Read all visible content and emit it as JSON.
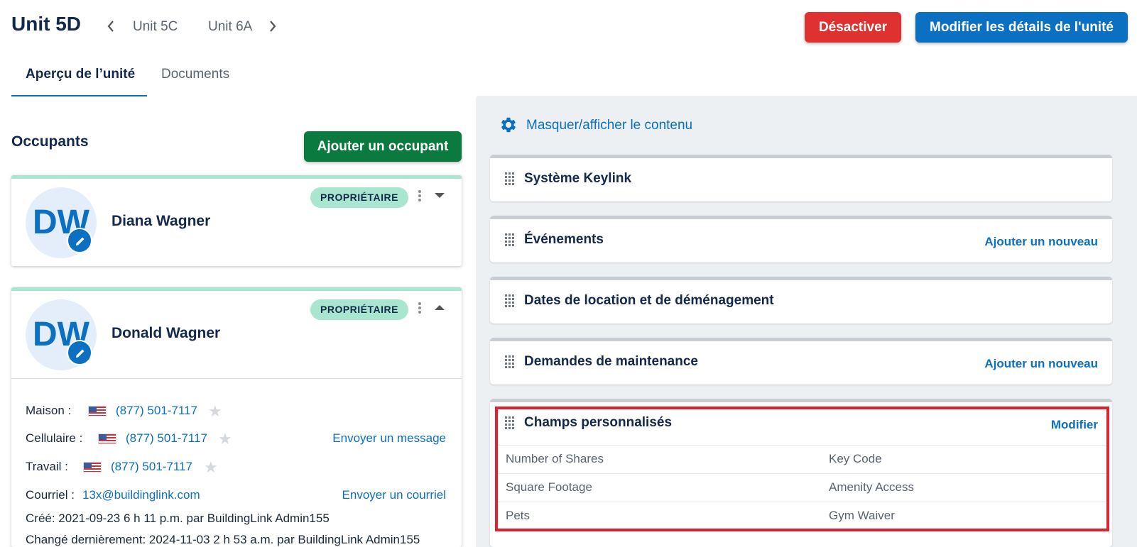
{
  "header": {
    "unit_title": "Unit 5D",
    "prev_unit": "Unit 5C",
    "next_unit": "Unit 6A",
    "deactivate_label": "Désactiver",
    "edit_unit_label": "Modifier les détails de l'unité"
  },
  "tabs": [
    {
      "label": "Aperçu de l’unité",
      "active": true
    },
    {
      "label": "Documents",
      "active": false
    }
  ],
  "occupants": {
    "title": "Occupants",
    "add_label": "Ajouter un occupant",
    "list": [
      {
        "initials": "DW",
        "name": "Diana Wagner",
        "role": "PROPRIÉTAIRE",
        "expanded": false
      },
      {
        "initials": "DW",
        "name": "Donald Wagner",
        "role": "PROPRIÉTAIRE",
        "expanded": true,
        "contacts": {
          "home_label": "Maison :",
          "home_phone": "(877) 501-7117",
          "cell_label": "Cellulaire :",
          "cell_phone": "(877) 501-7117",
          "work_label": "Travail :",
          "work_phone": "(877) 501-7117",
          "send_message": "Envoyer un message",
          "email_label": "Courriel :",
          "email": "13x@buildinglink.com",
          "send_email": "Envoyer un courriel",
          "created": "Créé:  2021-09-23 6 h 11 p.m. par BuildingLink Admin155",
          "changed": "Changé dernièrement:  2024-11-03 2 h 53 a.m. par BuildingLink Admin155"
        }
      }
    ]
  },
  "right_panel": {
    "toggle_label": "Masquer/afficher le contenu",
    "sections": [
      {
        "title": "Système Keylink",
        "action": ""
      },
      {
        "title": "Événements",
        "action": "Ajouter un nouveau"
      },
      {
        "title": "Dates de location et de déménagement",
        "action": ""
      },
      {
        "title": "Demandes de maintenance",
        "action": "Ajouter un nouveau"
      },
      {
        "title": "Champs personnalisés",
        "action": "Modifier"
      }
    ],
    "custom_fields": [
      [
        "Number of Shares",
        "Key Code"
      ],
      [
        "Square Footage",
        "Amenity Access"
      ],
      [
        "Pets",
        "Gym Waiver"
      ]
    ]
  },
  "colors": {
    "primary": "#0b6fc2",
    "danger": "#e03131",
    "success": "#0a7a3e",
    "badge": "#a8e6cf",
    "highlight": "#e0212f"
  }
}
